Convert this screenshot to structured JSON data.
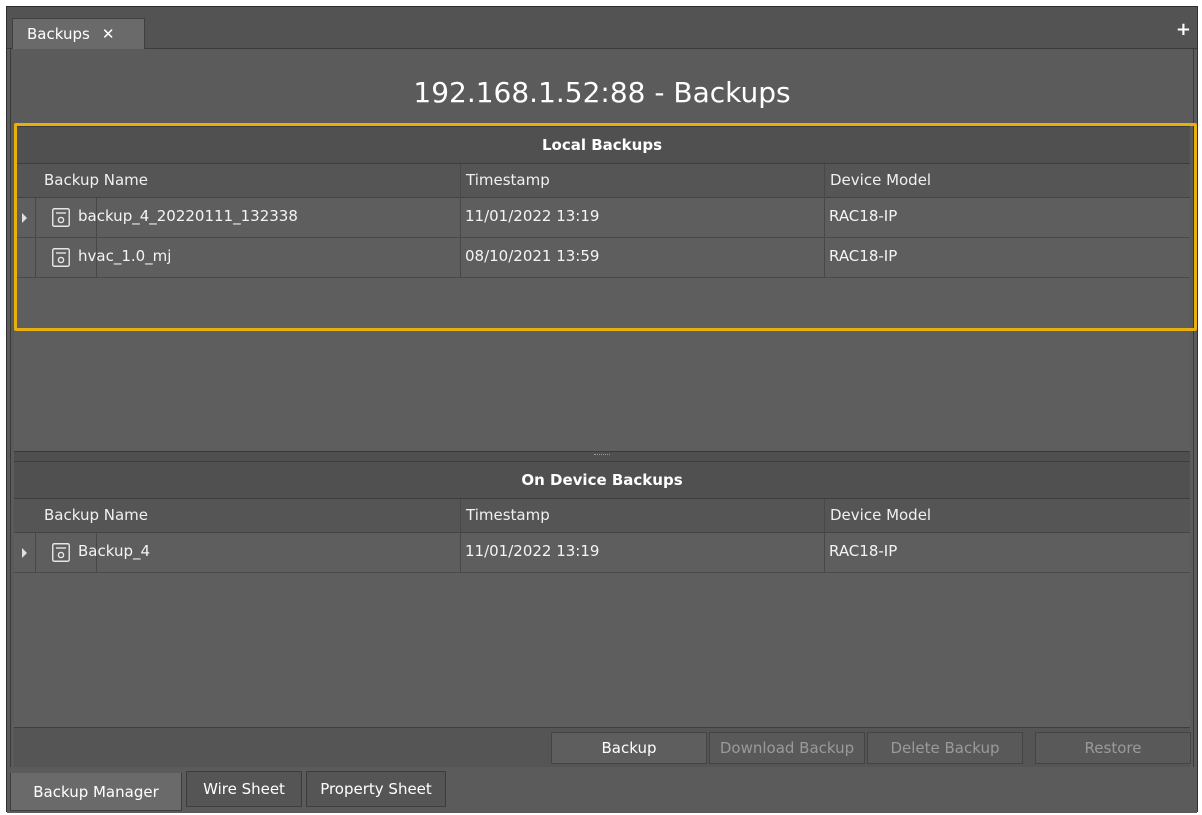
{
  "tab": {
    "title": "Backups",
    "close_glyph": "✕",
    "add_glyph": "+"
  },
  "page_title": "192.168.1.52:88 - Backups",
  "local": {
    "header": "Local Backups",
    "columns": [
      "Backup Name",
      "Timestamp",
      "Device Model"
    ],
    "rows": [
      {
        "name": "backup_4_20220111_132338",
        "timestamp": "11/01/2022 13:19",
        "model": "RAC18-IP",
        "icon": "disk-icon"
      },
      {
        "name": "hvac_1.0_mj",
        "timestamp": "08/10/2021 13:59",
        "model": "RAC18-IP",
        "icon": "disk-icon"
      }
    ]
  },
  "device": {
    "header": "On Device Backups",
    "columns": [
      "Backup Name",
      "Timestamp",
      "Device Model"
    ],
    "rows": [
      {
        "name": "Backup_4",
        "timestamp": "11/01/2022 13:19",
        "model": "RAC18-IP",
        "icon": "disk-icon"
      }
    ]
  },
  "buttons": {
    "backup": "Backup",
    "download": "Download Backup",
    "delete": "Delete Backup",
    "restore": "Restore"
  },
  "bottom_tabs": [
    "Backup Manager",
    "Wire Sheet",
    "Property Sheet"
  ],
  "colors": {
    "highlight": "#e8b00d",
    "background": "#5b5b5b"
  }
}
